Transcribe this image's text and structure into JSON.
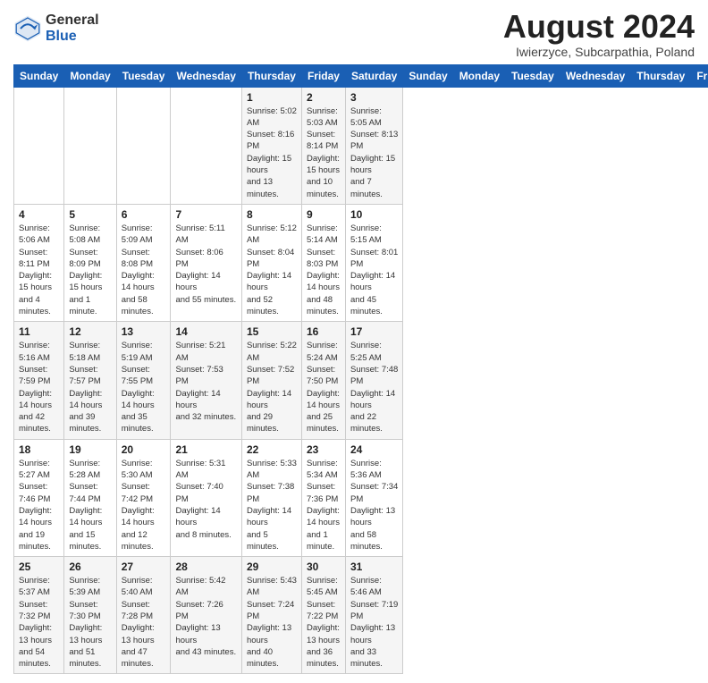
{
  "header": {
    "logo_general": "General",
    "logo_blue": "Blue",
    "month_year": "August 2024",
    "location": "Iwierzyce, Subcarpathia, Poland"
  },
  "weekdays": [
    "Sunday",
    "Monday",
    "Tuesday",
    "Wednesday",
    "Thursday",
    "Friday",
    "Saturday"
  ],
  "weeks": [
    [
      {
        "day": "",
        "info": ""
      },
      {
        "day": "",
        "info": ""
      },
      {
        "day": "",
        "info": ""
      },
      {
        "day": "",
        "info": ""
      },
      {
        "day": "1",
        "info": "Sunrise: 5:02 AM\nSunset: 8:16 PM\nDaylight: 15 hours\nand 13 minutes."
      },
      {
        "day": "2",
        "info": "Sunrise: 5:03 AM\nSunset: 8:14 PM\nDaylight: 15 hours\nand 10 minutes."
      },
      {
        "day": "3",
        "info": "Sunrise: 5:05 AM\nSunset: 8:13 PM\nDaylight: 15 hours\nand 7 minutes."
      }
    ],
    [
      {
        "day": "4",
        "info": "Sunrise: 5:06 AM\nSunset: 8:11 PM\nDaylight: 15 hours\nand 4 minutes."
      },
      {
        "day": "5",
        "info": "Sunrise: 5:08 AM\nSunset: 8:09 PM\nDaylight: 15 hours\nand 1 minute."
      },
      {
        "day": "6",
        "info": "Sunrise: 5:09 AM\nSunset: 8:08 PM\nDaylight: 14 hours\nand 58 minutes."
      },
      {
        "day": "7",
        "info": "Sunrise: 5:11 AM\nSunset: 8:06 PM\nDaylight: 14 hours\nand 55 minutes."
      },
      {
        "day": "8",
        "info": "Sunrise: 5:12 AM\nSunset: 8:04 PM\nDaylight: 14 hours\nand 52 minutes."
      },
      {
        "day": "9",
        "info": "Sunrise: 5:14 AM\nSunset: 8:03 PM\nDaylight: 14 hours\nand 48 minutes."
      },
      {
        "day": "10",
        "info": "Sunrise: 5:15 AM\nSunset: 8:01 PM\nDaylight: 14 hours\nand 45 minutes."
      }
    ],
    [
      {
        "day": "11",
        "info": "Sunrise: 5:16 AM\nSunset: 7:59 PM\nDaylight: 14 hours\nand 42 minutes."
      },
      {
        "day": "12",
        "info": "Sunrise: 5:18 AM\nSunset: 7:57 PM\nDaylight: 14 hours\nand 39 minutes."
      },
      {
        "day": "13",
        "info": "Sunrise: 5:19 AM\nSunset: 7:55 PM\nDaylight: 14 hours\nand 35 minutes."
      },
      {
        "day": "14",
        "info": "Sunrise: 5:21 AM\nSunset: 7:53 PM\nDaylight: 14 hours\nand 32 minutes."
      },
      {
        "day": "15",
        "info": "Sunrise: 5:22 AM\nSunset: 7:52 PM\nDaylight: 14 hours\nand 29 minutes."
      },
      {
        "day": "16",
        "info": "Sunrise: 5:24 AM\nSunset: 7:50 PM\nDaylight: 14 hours\nand 25 minutes."
      },
      {
        "day": "17",
        "info": "Sunrise: 5:25 AM\nSunset: 7:48 PM\nDaylight: 14 hours\nand 22 minutes."
      }
    ],
    [
      {
        "day": "18",
        "info": "Sunrise: 5:27 AM\nSunset: 7:46 PM\nDaylight: 14 hours\nand 19 minutes."
      },
      {
        "day": "19",
        "info": "Sunrise: 5:28 AM\nSunset: 7:44 PM\nDaylight: 14 hours\nand 15 minutes."
      },
      {
        "day": "20",
        "info": "Sunrise: 5:30 AM\nSunset: 7:42 PM\nDaylight: 14 hours\nand 12 minutes."
      },
      {
        "day": "21",
        "info": "Sunrise: 5:31 AM\nSunset: 7:40 PM\nDaylight: 14 hours\nand 8 minutes."
      },
      {
        "day": "22",
        "info": "Sunrise: 5:33 AM\nSunset: 7:38 PM\nDaylight: 14 hours\nand 5 minutes."
      },
      {
        "day": "23",
        "info": "Sunrise: 5:34 AM\nSunset: 7:36 PM\nDaylight: 14 hours\nand 1 minute."
      },
      {
        "day": "24",
        "info": "Sunrise: 5:36 AM\nSunset: 7:34 PM\nDaylight: 13 hours\nand 58 minutes."
      }
    ],
    [
      {
        "day": "25",
        "info": "Sunrise: 5:37 AM\nSunset: 7:32 PM\nDaylight: 13 hours\nand 54 minutes."
      },
      {
        "day": "26",
        "info": "Sunrise: 5:39 AM\nSunset: 7:30 PM\nDaylight: 13 hours\nand 51 minutes."
      },
      {
        "day": "27",
        "info": "Sunrise: 5:40 AM\nSunset: 7:28 PM\nDaylight: 13 hours\nand 47 minutes."
      },
      {
        "day": "28",
        "info": "Sunrise: 5:42 AM\nSunset: 7:26 PM\nDaylight: 13 hours\nand 43 minutes."
      },
      {
        "day": "29",
        "info": "Sunrise: 5:43 AM\nSunset: 7:24 PM\nDaylight: 13 hours\nand 40 minutes."
      },
      {
        "day": "30",
        "info": "Sunrise: 5:45 AM\nSunset: 7:22 PM\nDaylight: 13 hours\nand 36 minutes."
      },
      {
        "day": "31",
        "info": "Sunrise: 5:46 AM\nSunset: 7:19 PM\nDaylight: 13 hours\nand 33 minutes."
      }
    ]
  ]
}
